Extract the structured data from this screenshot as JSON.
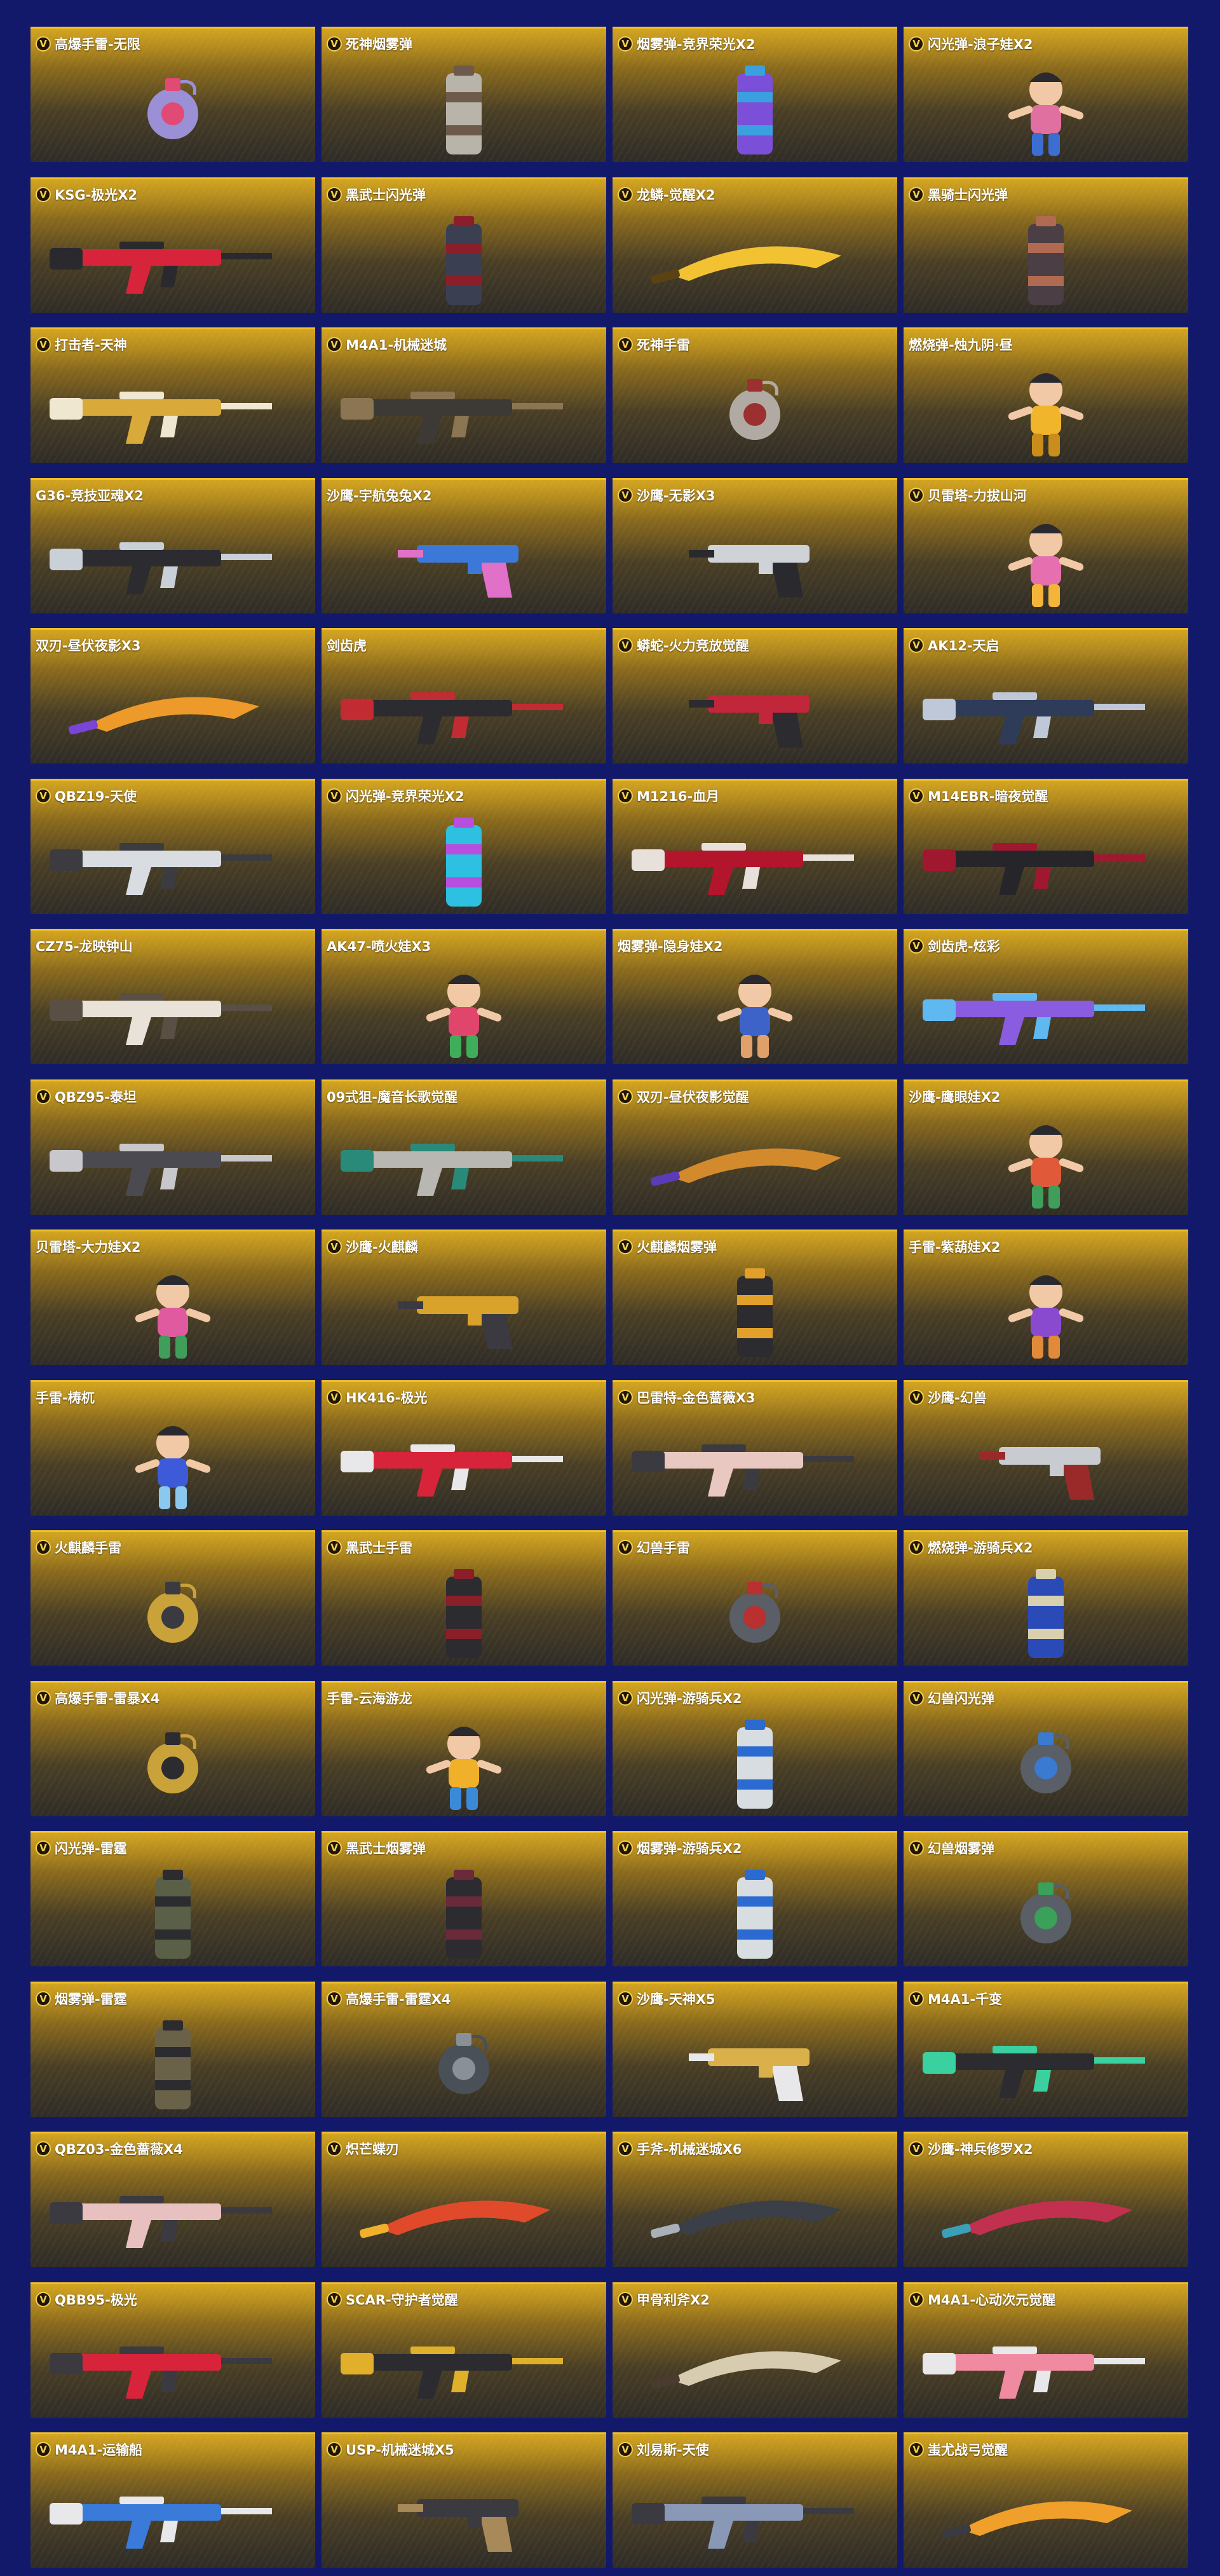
{
  "badge_letter": "V",
  "items": [
    {
      "name": "高爆手雷-无限",
      "vip": true,
      "kind": "grenade",
      "colors": [
        "#9b8fd6",
        "#e04a74"
      ]
    },
    {
      "name": "死神烟雾弹",
      "vip": true,
      "kind": "canister",
      "colors": [
        "#b9b4aa",
        "#6e5a4a"
      ]
    },
    {
      "name": "烟雾弹-竞界荣光X2",
      "vip": true,
      "kind": "canister",
      "colors": [
        "#7b4fd8",
        "#3aa0e0"
      ]
    },
    {
      "name": "闪光弹-浪子娃X2",
      "vip": true,
      "kind": "figure",
      "colors": [
        "#e070a0",
        "#3b6ed0"
      ]
    },
    {
      "name": "KSG-极光X2",
      "vip": true,
      "kind": "gun",
      "colors": [
        "#d8243a",
        "#2a2a2e"
      ]
    },
    {
      "name": "黑武士闪光弹",
      "vip": true,
      "kind": "canister",
      "colors": [
        "#3a3f52",
        "#8a1f2a"
      ]
    },
    {
      "name": "龙鳞-觉醒X2",
      "vip": true,
      "kind": "knife",
      "colors": [
        "#f3c232",
        "#5a4214"
      ]
    },
    {
      "name": "黑骑士闪光弹",
      "vip": true,
      "kind": "canister",
      "colors": [
        "#4b3e44",
        "#b06a52"
      ]
    },
    {
      "name": "打击者-天神",
      "vip": true,
      "kind": "gun",
      "colors": [
        "#d9aa3a",
        "#efe7d0"
      ]
    },
    {
      "name": "M4A1-机械迷城",
      "vip": true,
      "kind": "gun",
      "colors": [
        "#3d3a36",
        "#8b7553"
      ]
    },
    {
      "name": "死神手雷",
      "vip": true,
      "kind": "grenade",
      "colors": [
        "#b0aaa3",
        "#9c2f2f"
      ]
    },
    {
      "name": "燃烧弹-烛九阴·昼",
      "vip": false,
      "kind": "figure",
      "colors": [
        "#f0b52a",
        "#c98d1b"
      ]
    },
    {
      "name": "G36-竞技亚魂X2",
      "vip": false,
      "kind": "gun",
      "colors": [
        "#2b2b30",
        "#c9d0d8"
      ]
    },
    {
      "name": "沙鹰-宇航兔兔X2",
      "vip": false,
      "kind": "pistol",
      "colors": [
        "#3c78d8",
        "#e070c8"
      ]
    },
    {
      "name": "沙鹰-无影X3",
      "vip": true,
      "kind": "pistol",
      "colors": [
        "#cfd2d6",
        "#2a2a2e"
      ]
    },
    {
      "name": "贝雷塔-力拔山河",
      "vip": true,
      "kind": "figure",
      "colors": [
        "#e66fb0",
        "#f4b43a"
      ]
    },
    {
      "name": "双刃-昼伏夜影X3",
      "vip": false,
      "kind": "knife",
      "colors": [
        "#ee9a2a",
        "#7a44d6"
      ]
    },
    {
      "name": "剑齿虎",
      "vip": false,
      "kind": "gun",
      "colors": [
        "#2b2b30",
        "#c32b32"
      ]
    },
    {
      "name": "蟒蛇-火力竞放觉醒",
      "vip": true,
      "kind": "pistol",
      "colors": [
        "#c2263a",
        "#2b2b30"
      ]
    },
    {
      "name": "AK12-天启",
      "vip": true,
      "kind": "gun",
      "colors": [
        "#2e3c5a",
        "#bfc8d8"
      ]
    },
    {
      "name": "QBZ19-天使",
      "vip": true,
      "kind": "gun",
      "colors": [
        "#d9dde2",
        "#3b3b40"
      ]
    },
    {
      "name": "闪光弹-竞界荣光X2",
      "vip": true,
      "kind": "canister",
      "colors": [
        "#2ec0e0",
        "#b84ee0"
      ]
    },
    {
      "name": "M1216-血月",
      "vip": true,
      "kind": "gun",
      "colors": [
        "#b3152c",
        "#e8e0da"
      ]
    },
    {
      "name": "M14EBR-暗夜觉醒",
      "vip": true,
      "kind": "gun",
      "colors": [
        "#26262a",
        "#a01830"
      ]
    },
    {
      "name": "CZ75-龙映钟山",
      "vip": false,
      "kind": "gun",
      "colors": [
        "#e8e2d8",
        "#5a4f44"
      ]
    },
    {
      "name": "AK47-喷火娃X3",
      "vip": false,
      "kind": "figure",
      "colors": [
        "#e0456c",
        "#3fae5a"
      ]
    },
    {
      "name": "烟雾弹-隐身娃X2",
      "vip": false,
      "kind": "figure",
      "colors": [
        "#3e63c8",
        "#e0a06a"
      ]
    },
    {
      "name": "剑齿虎-炫彩",
      "vip": true,
      "kind": "gun",
      "colors": [
        "#8a5ce0",
        "#60b8f0"
      ]
    },
    {
      "name": "QBZ95-泰坦",
      "vip": true,
      "kind": "gun",
      "colors": [
        "#4a4a50",
        "#c8c8cc"
      ]
    },
    {
      "name": "09式狙-魔音长歌觉醒",
      "vip": false,
      "kind": "gun",
      "colors": [
        "#b9b7b2",
        "#2a8a7a"
      ]
    },
    {
      "name": "双刃-昼伏夜影觉醒",
      "vip": true,
      "kind": "knife",
      "colors": [
        "#d28a2c",
        "#5a3bb8"
      ]
    },
    {
      "name": "沙鹰-鹰眼娃X2",
      "vip": false,
      "kind": "figure",
      "colors": [
        "#e05a3a",
        "#3e9e5a"
      ]
    },
    {
      "name": "贝雷塔-大力娃X2",
      "vip": false,
      "kind": "figure",
      "colors": [
        "#e05aa0",
        "#3e9e5a"
      ]
    },
    {
      "name": "沙鹰-火麒麟",
      "vip": true,
      "kind": "pistol",
      "colors": [
        "#d9a22a",
        "#3a3a40"
      ]
    },
    {
      "name": "火麒麟烟雾弹",
      "vip": true,
      "kind": "canister",
      "colors": [
        "#2b2b30",
        "#e0a02a"
      ]
    },
    {
      "name": "手雷-紫葫娃X2",
      "vip": false,
      "kind": "figure",
      "colors": [
        "#8a4ad0",
        "#e08a3a"
      ]
    },
    {
      "name": "手雷-梼杌",
      "vip": false,
      "kind": "figure",
      "colors": [
        "#3d5ad8",
        "#8ac8f0"
      ]
    },
    {
      "name": "HK416-极光",
      "vip": true,
      "kind": "gun",
      "colors": [
        "#d8243a",
        "#e8e8ea"
      ]
    },
    {
      "name": "巴雷特-金色蔷薇X3",
      "vip": true,
      "kind": "gun",
      "colors": [
        "#e8c8c0",
        "#3a3a40"
      ]
    },
    {
      "name": "沙鹰-幻兽",
      "vip": true,
      "kind": "pistol",
      "colors": [
        "#c8ccd0",
        "#9a2a2a"
      ]
    },
    {
      "name": "火麒麟手雷",
      "vip": true,
      "kind": "grenade",
      "colors": [
        "#caa23a",
        "#3a3a40"
      ]
    },
    {
      "name": "黑武士手雷",
      "vip": true,
      "kind": "canister",
      "colors": [
        "#2b2b30",
        "#8a1f2a"
      ]
    },
    {
      "name": "幻兽手雷",
      "vip": true,
      "kind": "grenade",
      "colors": [
        "#5a5e66",
        "#b83030"
      ]
    },
    {
      "name": "燃烧弹-游骑兵X2",
      "vip": true,
      "kind": "canister",
      "colors": [
        "#2a4ab8",
        "#d9d0b0"
      ]
    },
    {
      "name": "高爆手雷-雷暴X4",
      "vip": true,
      "kind": "grenade",
      "colors": [
        "#c9a23a",
        "#2b2b30"
      ]
    },
    {
      "name": "手雷-云海游龙",
      "vip": false,
      "kind": "figure",
      "colors": [
        "#f0b02a",
        "#3a8ad8"
      ]
    },
    {
      "name": "闪光弹-游骑兵X2",
      "vip": true,
      "kind": "canister",
      "colors": [
        "#d8dde2",
        "#2b6ad0"
      ]
    },
    {
      "name": "幻兽闪光弹",
      "vip": true,
      "kind": "grenade",
      "colors": [
        "#5a5e66",
        "#3a7ad0"
      ]
    },
    {
      "name": "闪光弹-雷霆",
      "vip": true,
      "kind": "canister",
      "colors": [
        "#5a6048",
        "#2b2b30"
      ]
    },
    {
      "name": "黑武士烟雾弹",
      "vip": true,
      "kind": "canister",
      "colors": [
        "#2b2b30",
        "#6a2a3a"
      ]
    },
    {
      "name": "烟雾弹-游骑兵X2",
      "vip": true,
      "kind": "canister",
      "colors": [
        "#d8dde2",
        "#2b6ad0"
      ]
    },
    {
      "name": "幻兽烟雾弹",
      "vip": true,
      "kind": "grenade",
      "colors": [
        "#5a5e66",
        "#3aa05a"
      ]
    },
    {
      "name": "烟雾弹-雷霆",
      "vip": true,
      "kind": "canister",
      "colors": [
        "#6a6248",
        "#2b2b30"
      ]
    },
    {
      "name": "高爆手雷-雷霆X4",
      "vip": true,
      "kind": "grenade",
      "colors": [
        "#4a5058",
        "#8a9098"
      ]
    },
    {
      "name": "沙鹰-天神X5",
      "vip": true,
      "kind": "pistol",
      "colors": [
        "#d9b04a",
        "#e8e8ea"
      ]
    },
    {
      "name": "M4A1-千变",
      "vip": true,
      "kind": "gun",
      "colors": [
        "#2b2b30",
        "#3ad0a0"
      ]
    },
    {
      "name": "QBZ03-金色蔷薇X4",
      "vip": true,
      "kind": "gun",
      "colors": [
        "#e8c0c0",
        "#3a3a40"
      ]
    },
    {
      "name": "炽芒蝶刃",
      "vip": true,
      "kind": "knife",
      "colors": [
        "#e04a2a",
        "#f0b02a"
      ]
    },
    {
      "name": "手斧-机械迷城X6",
      "vip": true,
      "kind": "knife",
      "colors": [
        "#3a3f48",
        "#aab0b8"
      ]
    },
    {
      "name": "沙鹰-神兵修罗X2",
      "vip": true,
      "kind": "knife",
      "colors": [
        "#c23050",
        "#3aa0b8"
      ]
    },
    {
      "name": "QBB95-极光",
      "vip": true,
      "kind": "gun",
      "colors": [
        "#d8243a",
        "#3a3a40"
      ]
    },
    {
      "name": "SCAR-守护者觉醒",
      "vip": true,
      "kind": "gun",
      "colors": [
        "#2b2b30",
        "#e0b02a"
      ]
    },
    {
      "name": "甲骨利斧X2",
      "vip": true,
      "kind": "knife",
      "colors": [
        "#d8ccb0",
        "#4a3a30"
      ]
    },
    {
      "name": "M4A1-心动次元觉醒",
      "vip": true,
      "kind": "gun",
      "colors": [
        "#f08aa0",
        "#e8e8ea"
      ]
    },
    {
      "name": "M4A1-运输船",
      "vip": true,
      "kind": "gun",
      "colors": [
        "#3a7ad8",
        "#e8e8ea"
      ]
    },
    {
      "name": "USP-机械迷城X5",
      "vip": true,
      "kind": "pistol",
      "colors": [
        "#3a3a40",
        "#a88a5a"
      ]
    },
    {
      "name": "刘易斯-天使",
      "vip": true,
      "kind": "gun",
      "colors": [
        "#8a98b8",
        "#3a3a40"
      ]
    },
    {
      "name": "蚩尤战弓觉醒",
      "vip": true,
      "kind": "knife",
      "colors": [
        "#f0a02a",
        "#3a3a40"
      ]
    }
  ]
}
